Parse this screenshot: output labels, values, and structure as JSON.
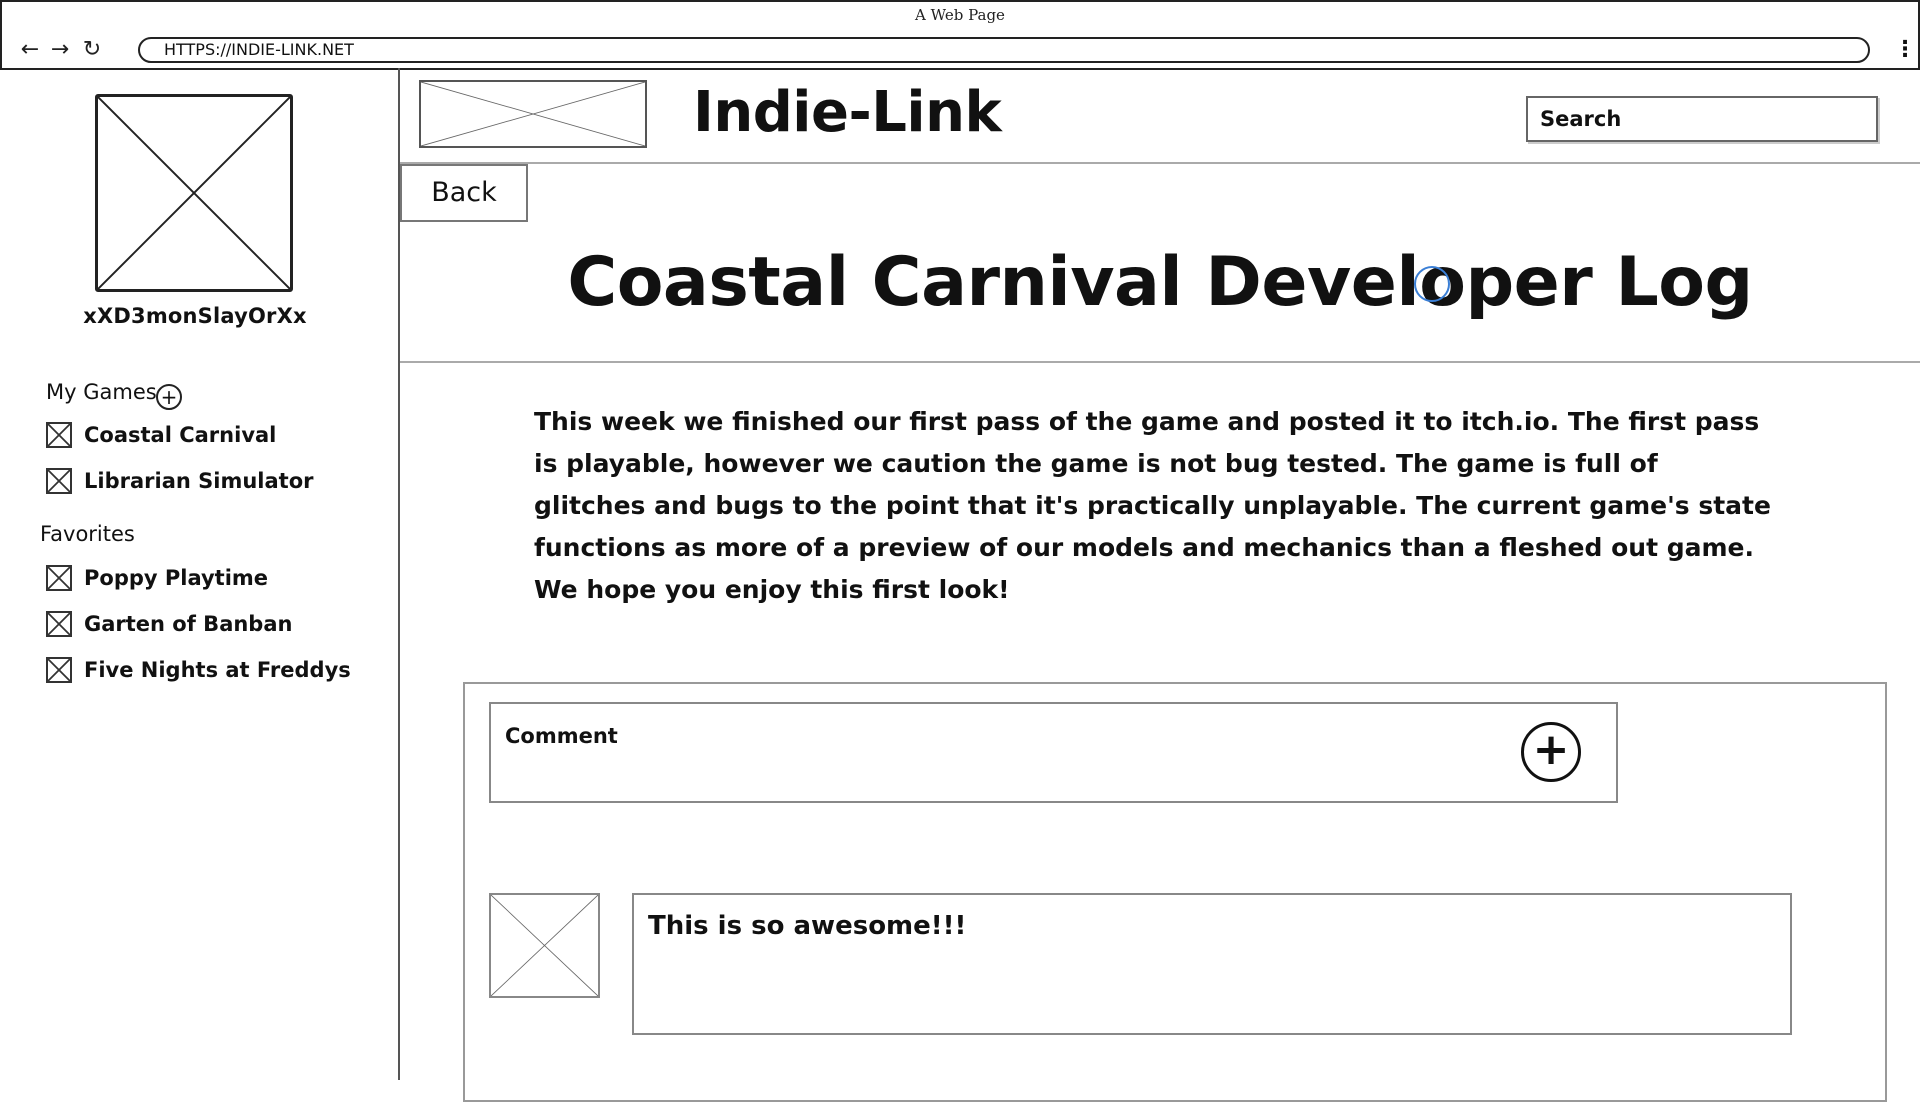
{
  "browser": {
    "window_title": "A Web Page",
    "url": "HTTPS://INDIE-LINK.NET"
  },
  "sidebar": {
    "username": "xXD3monSlayOrXx",
    "my_games_heading": "My Games",
    "my_games": [
      {
        "label": "Coastal Carnival"
      },
      {
        "label": "Librarian Simulator"
      }
    ],
    "favorites_heading": "Favorites",
    "favorites": [
      {
        "label": "Poppy Playtime"
      },
      {
        "label": "Garten of Banban"
      },
      {
        "label": "Five Nights at Freddys"
      }
    ]
  },
  "header": {
    "site_title": "Indie-Link",
    "search_text": "Search"
  },
  "main": {
    "back_label": "Back",
    "title": "Coastal Carnival Developer Log",
    "body": "This week we finished our first pass of the game and posted it to itch.io. The first pass is playable, however we caution the game is not bug tested. The game is full of glitches and bugs to the point that it's practically unplayable. The current game's state functions as more of a preview of our models and mechanics than a fleshed out game. We hope you enjoy this first look!"
  },
  "comments": {
    "input_label": "Comment",
    "items": [
      {
        "text": "This is so awesome!!!"
      }
    ]
  }
}
